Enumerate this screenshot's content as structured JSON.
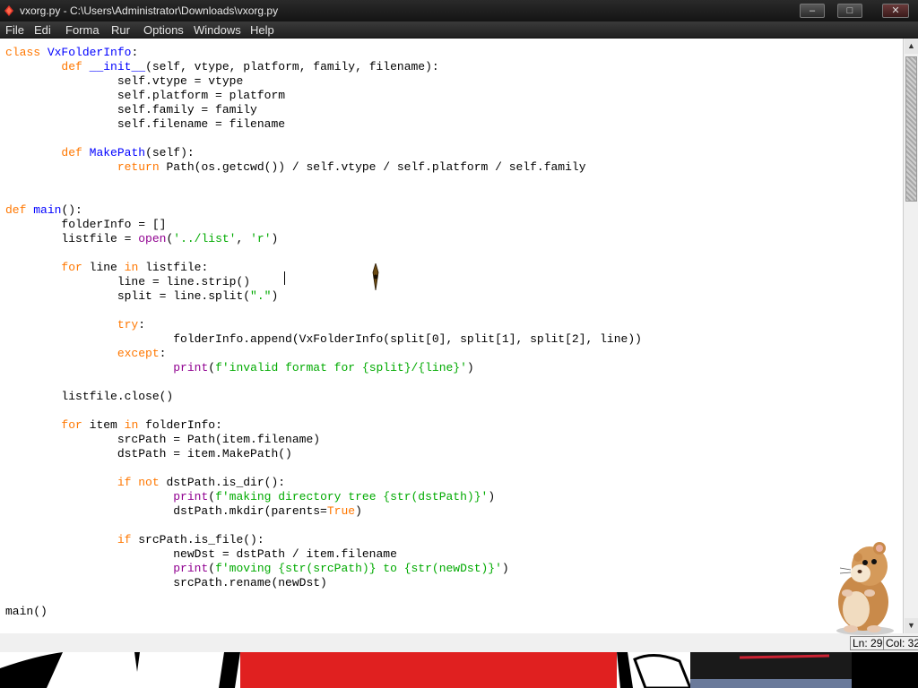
{
  "window": {
    "title": "vxorg.py - C:\\Users\\Administrator\\Downloads\\vxorg.py",
    "controls": [
      "–",
      "□",
      "✕"
    ]
  },
  "menu": [
    "File",
    "Edi",
    "Forma",
    "Rur",
    "Options",
    "Windows",
    "Help"
  ],
  "editor": {
    "lines": [
      [
        {
          "t": "class ",
          "c": "kw"
        },
        {
          "t": "VxFolderInfo",
          "c": "def"
        },
        {
          "t": ":"
        }
      ],
      [
        {
          "t": "        "
        },
        {
          "t": "def ",
          "c": "kw"
        },
        {
          "t": "__init__",
          "c": "def"
        },
        {
          "t": "(self, vtype, platform, family, filename):"
        }
      ],
      [
        {
          "t": "                self.vtype = vtype"
        }
      ],
      [
        {
          "t": "                self.platform = platform"
        }
      ],
      [
        {
          "t": "                self.family = family"
        }
      ],
      [
        {
          "t": "                self.filename = filename"
        }
      ],
      [
        {
          "t": ""
        }
      ],
      [
        {
          "t": "        "
        },
        {
          "t": "def ",
          "c": "kw"
        },
        {
          "t": "MakePath",
          "c": "def"
        },
        {
          "t": "(self):"
        }
      ],
      [
        {
          "t": "                "
        },
        {
          "t": "return ",
          "c": "kw"
        },
        {
          "t": "Path(os.getcwd()) / self.vtype / self.platform / self.family"
        }
      ],
      [
        {
          "t": ""
        }
      ],
      [
        {
          "t": ""
        }
      ],
      [
        {
          "t": "def ",
          "c": "kw"
        },
        {
          "t": "main",
          "c": "def"
        },
        {
          "t": "():"
        }
      ],
      [
        {
          "t": "        folderInfo = []"
        }
      ],
      [
        {
          "t": "        listfile = "
        },
        {
          "t": "open",
          "c": "bi"
        },
        {
          "t": "("
        },
        {
          "t": "'../list'",
          "c": "str"
        },
        {
          "t": ", "
        },
        {
          "t": "'r'",
          "c": "str"
        },
        {
          "t": ")"
        }
      ],
      [
        {
          "t": ""
        }
      ],
      [
        {
          "t": "        "
        },
        {
          "t": "for ",
          "c": "kw"
        },
        {
          "t": "line "
        },
        {
          "t": "in ",
          "c": "kw"
        },
        {
          "t": "listfile:"
        }
      ],
      [
        {
          "t": "                line = line.strip()"
        }
      ],
      [
        {
          "t": "                split = line.split("
        },
        {
          "t": "\".\"",
          "c": "str"
        },
        {
          "t": ")"
        }
      ],
      [
        {
          "t": ""
        }
      ],
      [
        {
          "t": "                "
        },
        {
          "t": "try",
          "c": "kw"
        },
        {
          "t": ":"
        }
      ],
      [
        {
          "t": "                        folderInfo.append(VxFolderInfo(split[0], split[1], split[2], line))"
        }
      ],
      [
        {
          "t": "                "
        },
        {
          "t": "except",
          "c": "kw"
        },
        {
          "t": ":"
        }
      ],
      [
        {
          "t": "                        "
        },
        {
          "t": "print",
          "c": "bi"
        },
        {
          "t": "("
        },
        {
          "t": "f'invalid format for {split}/{line}'",
          "c": "str"
        },
        {
          "t": ")"
        }
      ],
      [
        {
          "t": ""
        }
      ],
      [
        {
          "t": "        listfile.close()"
        }
      ],
      [
        {
          "t": ""
        }
      ],
      [
        {
          "t": "        "
        },
        {
          "t": "for ",
          "c": "kw"
        },
        {
          "t": "item "
        },
        {
          "t": "in ",
          "c": "kw"
        },
        {
          "t": "folderInfo:"
        }
      ],
      [
        {
          "t": "                srcPath = Path(item.filename)"
        }
      ],
      [
        {
          "t": "                dstPath = item.MakePath()"
        }
      ],
      [
        {
          "t": ""
        }
      ],
      [
        {
          "t": "                "
        },
        {
          "t": "if not ",
          "c": "kw"
        },
        {
          "t": "dstPath.is_dir():"
        }
      ],
      [
        {
          "t": "                        "
        },
        {
          "t": "print",
          "c": "bi"
        },
        {
          "t": "("
        },
        {
          "t": "f'making directory tree {str(dstPath)}'",
          "c": "str"
        },
        {
          "t": ")"
        }
      ],
      [
        {
          "t": "                        dstPath.mkdir(parents="
        },
        {
          "t": "True",
          "c": "kw"
        },
        {
          "t": ")"
        }
      ],
      [
        {
          "t": ""
        }
      ],
      [
        {
          "t": "                "
        },
        {
          "t": "if ",
          "c": "kw"
        },
        {
          "t": "srcPath.is_file():"
        }
      ],
      [
        {
          "t": "                        newDst = dstPath / item.filename"
        }
      ],
      [
        {
          "t": "                        "
        },
        {
          "t": "print",
          "c": "bi"
        },
        {
          "t": "("
        },
        {
          "t": "f'moving {str(srcPath)} to {str(newDst)}'",
          "c": "str"
        },
        {
          "t": ")"
        }
      ],
      [
        {
          "t": "                        srcPath.rename(newDst)"
        }
      ],
      [
        {
          "t": ""
        }
      ],
      [
        {
          "t": "main()"
        }
      ]
    ]
  },
  "scrollbar": {
    "position": 0.0,
    "visible_fraction": 0.25
  },
  "status": {
    "line": "Ln: 29",
    "col": "Col: 32"
  },
  "colors": {
    "keyword": "#ff7700",
    "definition": "#0000ff",
    "builtin": "#900090",
    "string": "#00aa00",
    "chrome": "#202020"
  }
}
